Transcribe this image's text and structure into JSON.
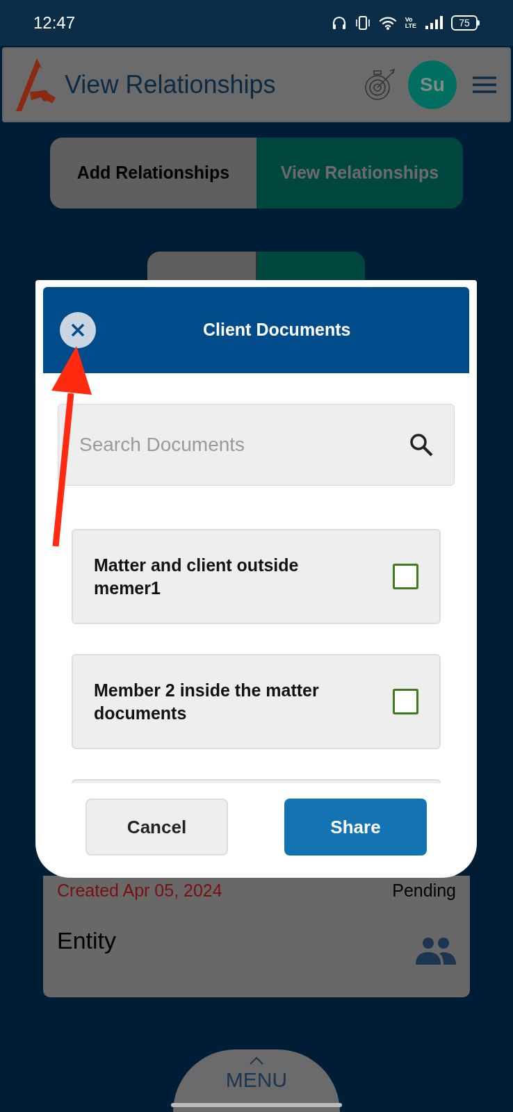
{
  "status_bar": {
    "time": "12:47",
    "network": [
      "Vo",
      "LTE"
    ],
    "battery": "75"
  },
  "header": {
    "title": "View Relationships",
    "avatar": "Su"
  },
  "tabs": [
    {
      "label": "Add Relationships",
      "selected": false
    },
    {
      "label": "View Relationships",
      "selected": true
    }
  ],
  "background_card": {
    "date": "Created Apr 05, 2024",
    "status": "Pending",
    "title": "Entity"
  },
  "dialog": {
    "title": "Client Documents",
    "search": {
      "placeholder": "Search Documents"
    },
    "documents": [
      {
        "name": "Matter and client outside memer1",
        "checked": false
      },
      {
        "name": "Member 2 inside the matter documents",
        "checked": false
      }
    ],
    "buttons": [
      {
        "label": "Cancel",
        "kind": "secondary"
      },
      {
        "label": "Share",
        "kind": "primary"
      }
    ]
  },
  "bottom_menu": {
    "label": "MENU"
  }
}
